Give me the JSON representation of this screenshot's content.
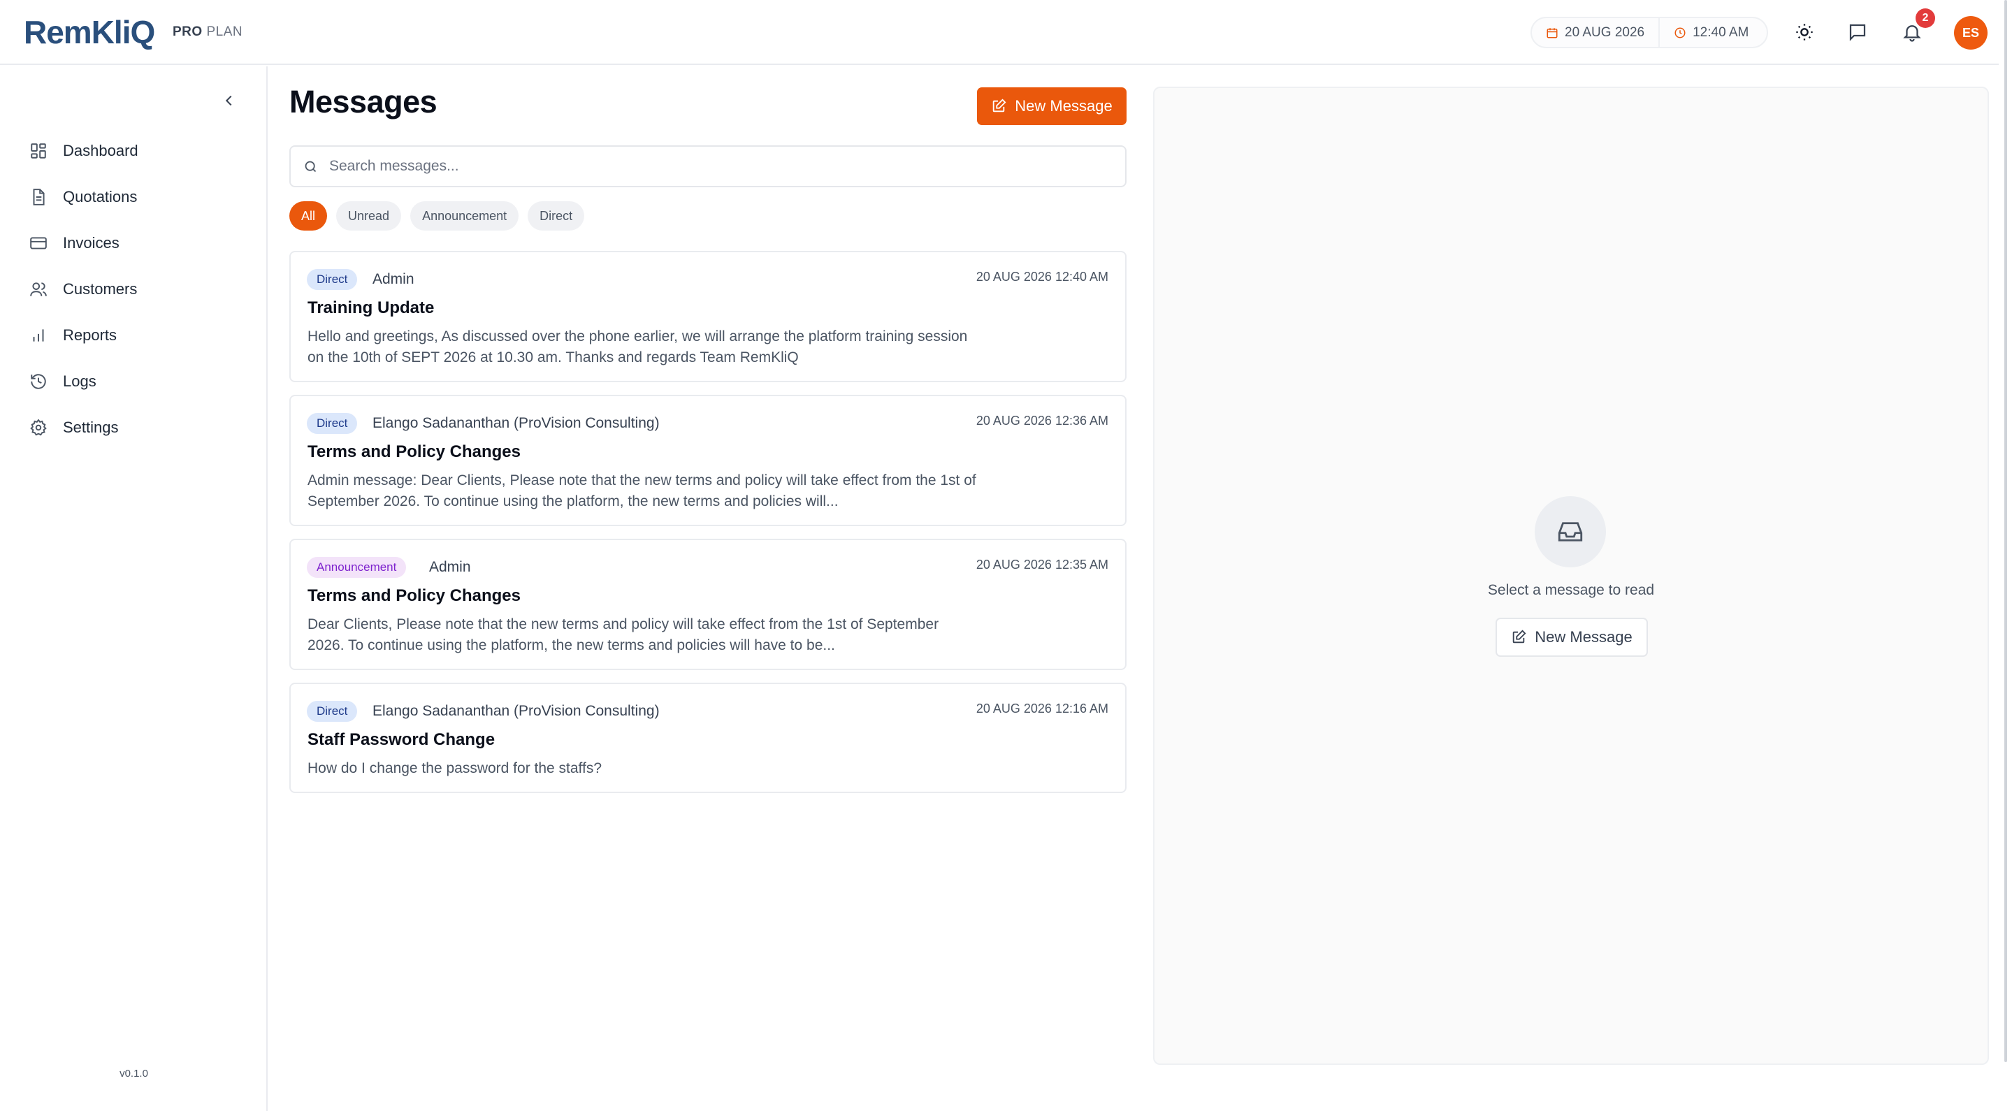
{
  "app": {
    "logo_text": "RemKliQ",
    "plan_bold": "PRO",
    "plan_rest": "PLAN",
    "version": "v0.1.0"
  },
  "header": {
    "date": "20 AUG 2026",
    "time": "12:40 AM",
    "notification_count": "2",
    "avatar_initials": "ES",
    "icons": [
      "calendar-icon",
      "clock-icon",
      "sun-icon",
      "chat-icon",
      "bell-icon"
    ]
  },
  "sidebar": {
    "items": [
      {
        "label": "Dashboard",
        "icon": "dashboard-icon"
      },
      {
        "label": "Quotations",
        "icon": "document-icon"
      },
      {
        "label": "Invoices",
        "icon": "credit-card-icon"
      },
      {
        "label": "Customers",
        "icon": "users-icon"
      },
      {
        "label": "Reports",
        "icon": "bar-chart-icon"
      },
      {
        "label": "Logs",
        "icon": "history-icon"
      },
      {
        "label": "Settings",
        "icon": "gear-icon"
      }
    ]
  },
  "messages": {
    "title": "Messages",
    "new_button": "New Message",
    "search_placeholder": "Search messages...",
    "filters": [
      "All",
      "Unread",
      "Announcement",
      "Direct"
    ],
    "active_filter": "All",
    "list": [
      {
        "tag": "Direct",
        "sender": "Admin",
        "timestamp": "20 AUG 2026 12:40 AM",
        "subject": "Training Update",
        "preview": "Hello and greetings, As discussed over the phone earlier, we will arrange the platform training session on the 10th of SEPT 2026 at 10.30 am. Thanks and regards Team RemKliQ"
      },
      {
        "tag": "Direct",
        "sender": "Elango Sadananthan (ProVision Consulting)",
        "timestamp": "20 AUG 2026 12:36 AM",
        "subject": "Terms and Policy Changes",
        "preview": "Admin message: Dear Clients, Please note that the new terms and policy will take effect from the 1st of September 2026. To continue using the platform, the new terms and policies will..."
      },
      {
        "tag": "Announcement",
        "sender": "Admin",
        "timestamp": "20 AUG 2026 12:35 AM",
        "subject": "Terms and Policy Changes",
        "preview": "Dear Clients, Please note that the new terms and policy will take effect from the 1st of September 2026. To continue using the platform, the new terms and policies will have to be..."
      },
      {
        "tag": "Direct",
        "sender": "Elango Sadananthan (ProVision Consulting)",
        "timestamp": "20 AUG 2026 12:16 AM",
        "subject": "Staff Password Change",
        "preview": "How do I change the password for the staffs?"
      }
    ]
  },
  "reader": {
    "empty_text": "Select a message to read",
    "new_button": "New Message"
  },
  "colors": {
    "accent": "#ea580c",
    "brand_blue": "#2a4f7c",
    "direct_tag_bg": "#dbe7fb",
    "announcement_tag_bg": "#f3e3f9",
    "badge_red": "#e23b3b"
  }
}
